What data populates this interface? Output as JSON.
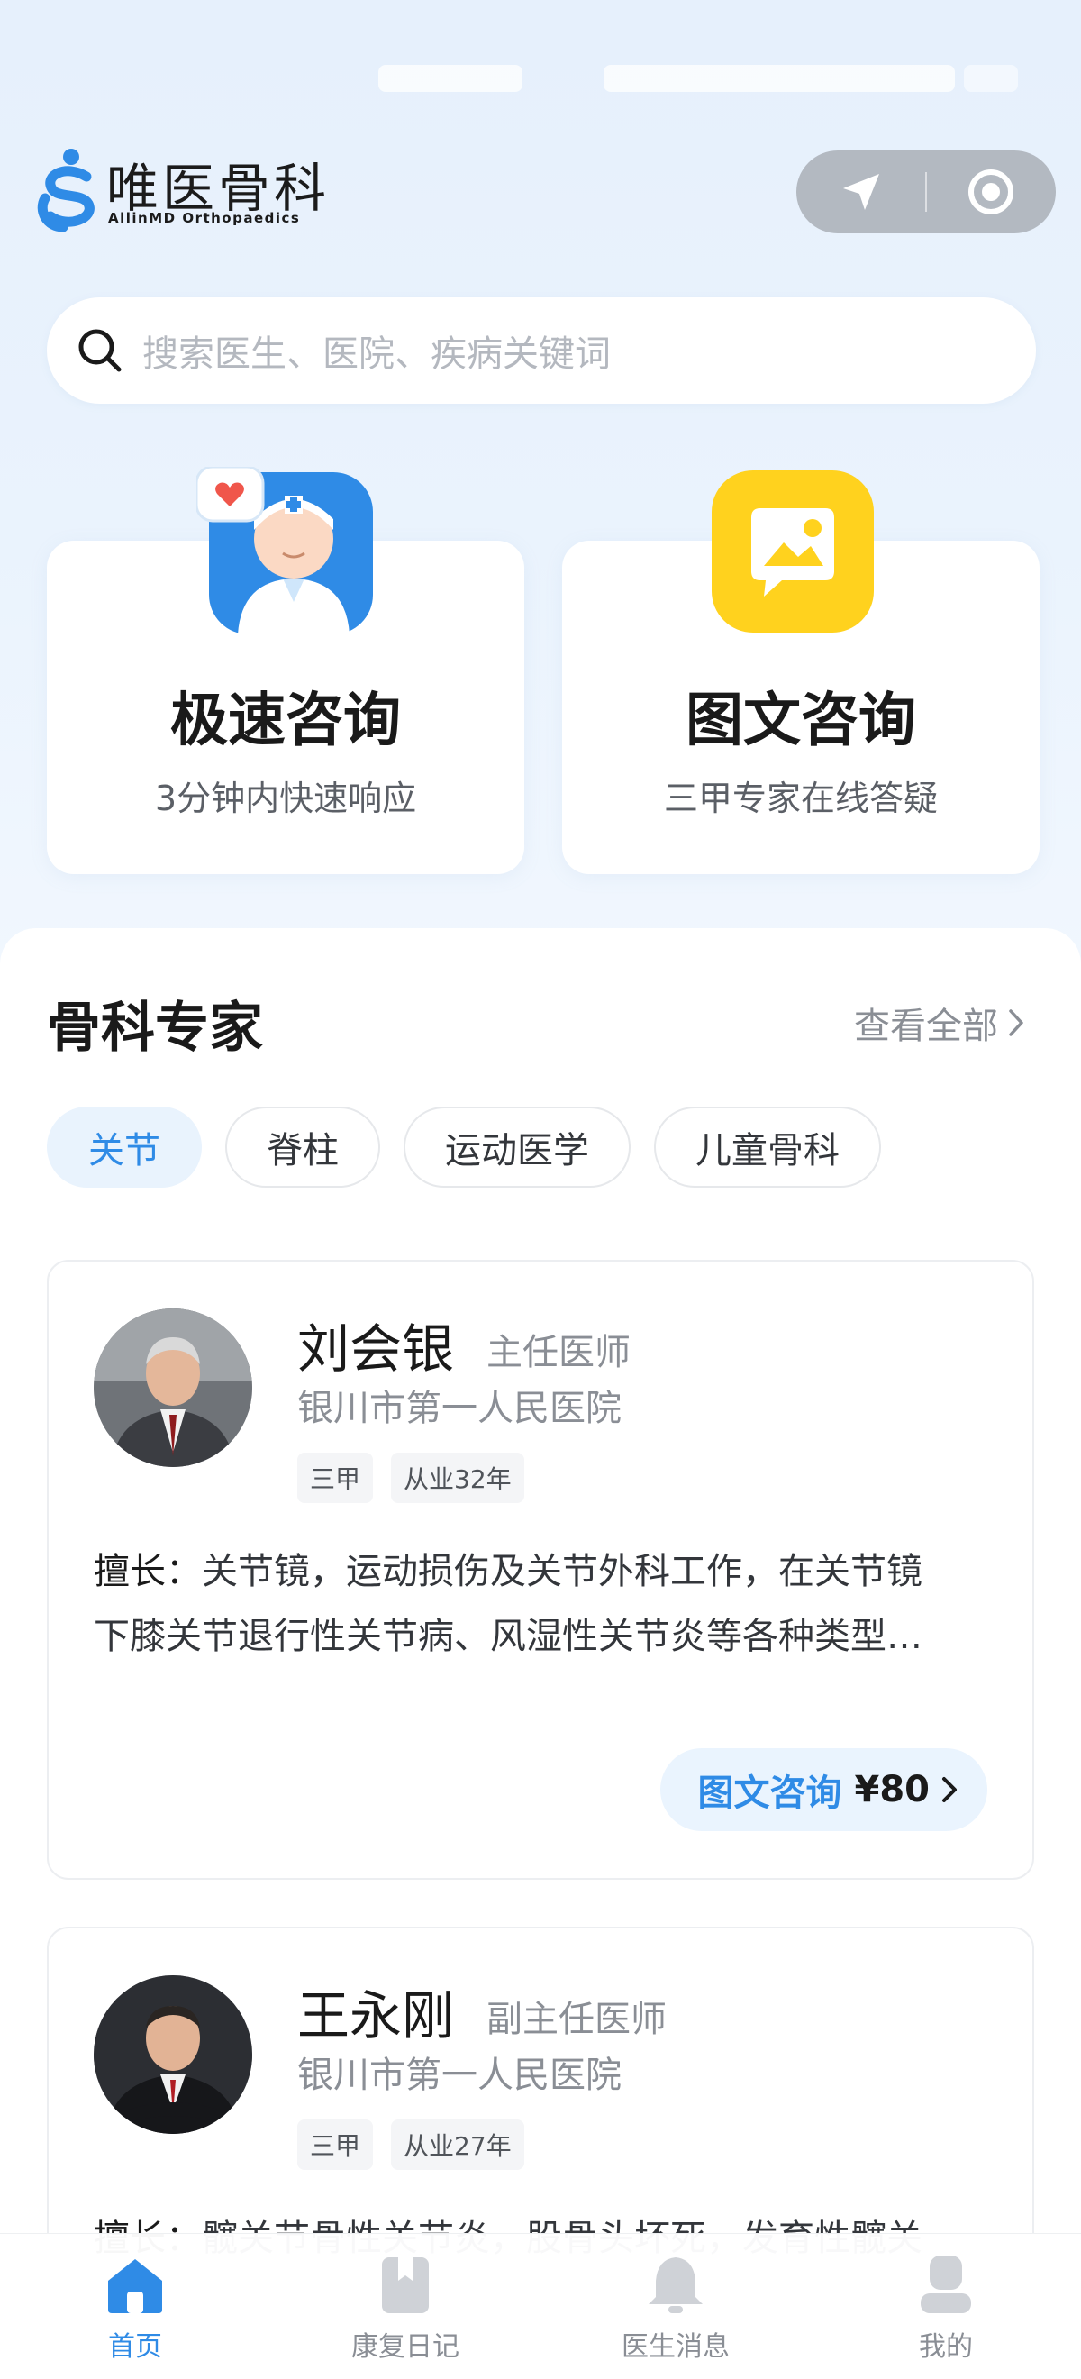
{
  "brand": {
    "name": "唯医骨科",
    "subtitle": "AllinMD Orthopaedics"
  },
  "capsule": {
    "location_icon": "navigation-arrow-icon",
    "target_icon": "record-circle-icon"
  },
  "search": {
    "placeholder": "搜索医生、医院、疾病关键词",
    "icon": "search-icon"
  },
  "consult_cards": [
    {
      "title": "极速咨询",
      "subtitle": "3分钟内快速响应",
      "icon": "doctor-avatar-icon"
    },
    {
      "title": "图文咨询",
      "subtitle": "三甲专家在线答疑",
      "icon": "picture-message-icon"
    }
  ],
  "experts": {
    "title": "骨科专家",
    "view_all": "查看全部",
    "tabs": [
      "关节",
      "脊柱",
      "运动医学",
      "儿童骨科"
    ],
    "active_tab": "关节",
    "doctors": [
      {
        "name": "刘会银",
        "title": "主任医师",
        "hospital": "银川市第一人民医院",
        "tags": [
          "三甲",
          "从业32年"
        ],
        "skill_label": "擅长：",
        "skill_line1": "关节镜，运动损伤及关节外科工作，在关节镜",
        "skill_line2": "下膝关节退行性关节病、风湿性关节炎等各种类型…",
        "cta_label": "图文咨询",
        "cta_price": "¥80"
      },
      {
        "name": "王永刚",
        "title": "副主任医师",
        "hospital": "银川市第一人民医院",
        "tags": [
          "三甲",
          "从业27年"
        ],
        "skill_label": "擅长：",
        "skill_line1": "髋关节骨性关节炎，股骨头坏死，发育性髋关"
      }
    ]
  },
  "bottom_nav": [
    {
      "label": "首页",
      "icon": "home-icon",
      "active": true
    },
    {
      "label": "康复日记",
      "icon": "diary-book-icon",
      "active": false
    },
    {
      "label": "医生消息",
      "icon": "bell-icon",
      "active": false
    },
    {
      "label": "我的",
      "icon": "user-icon",
      "active": false
    }
  ],
  "colors": {
    "accent": "#2f8be6",
    "background_top": "#e6f0fc",
    "capsule": "#b3b9c1"
  }
}
